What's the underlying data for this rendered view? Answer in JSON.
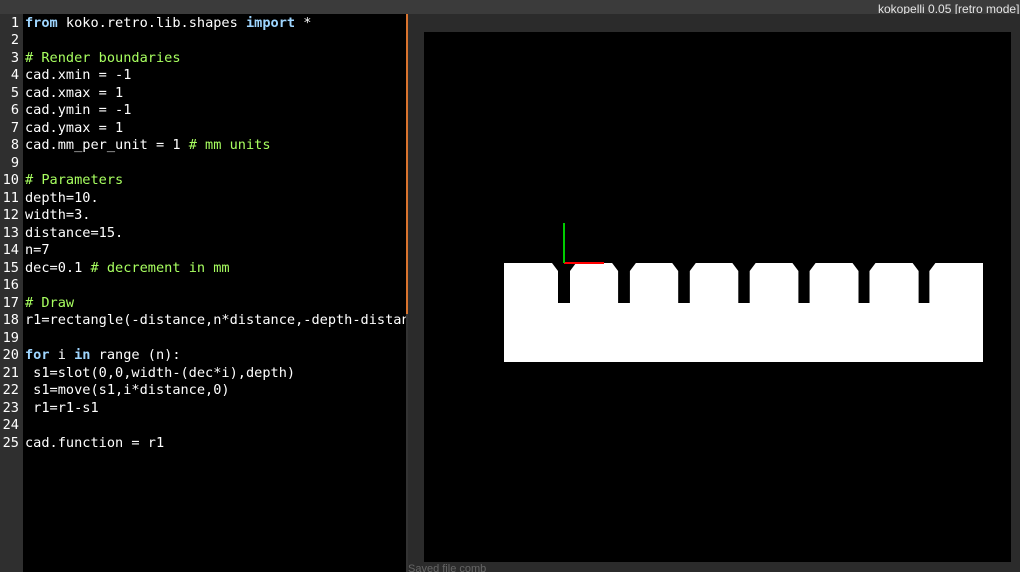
{
  "window": {
    "title": "kokopelli 0.05 [retro mode]"
  },
  "editor": {
    "lines": [
      {
        "num": "1",
        "tokens": [
          {
            "t": "from",
            "c": "kw"
          },
          {
            "t": " koko.retro.lib.shapes ",
            "c": ""
          },
          {
            "t": "import",
            "c": "kw"
          },
          {
            "t": " *",
            "c": ""
          }
        ]
      },
      {
        "num": "2",
        "tokens": []
      },
      {
        "num": "3",
        "tokens": [
          {
            "t": "# Render boundaries",
            "c": "cm"
          }
        ]
      },
      {
        "num": "4",
        "tokens": [
          {
            "t": "cad.xmin = -1",
            "c": ""
          }
        ]
      },
      {
        "num": "5",
        "tokens": [
          {
            "t": "cad.xmax = 1",
            "c": ""
          }
        ]
      },
      {
        "num": "6",
        "tokens": [
          {
            "t": "cad.ymin = -1",
            "c": ""
          }
        ]
      },
      {
        "num": "7",
        "tokens": [
          {
            "t": "cad.ymax = 1",
            "c": ""
          }
        ]
      },
      {
        "num": "8",
        "tokens": [
          {
            "t": "cad.mm_per_unit = 1 ",
            "c": ""
          },
          {
            "t": "# mm units",
            "c": "cm"
          }
        ]
      },
      {
        "num": "9",
        "tokens": []
      },
      {
        "num": "10",
        "tokens": [
          {
            "t": "# Parameters",
            "c": "cm"
          }
        ]
      },
      {
        "num": "11",
        "tokens": [
          {
            "t": "depth=10.",
            "c": ""
          }
        ]
      },
      {
        "num": "12",
        "tokens": [
          {
            "t": "width=3.",
            "c": ""
          }
        ]
      },
      {
        "num": "13",
        "tokens": [
          {
            "t": "distance=15.",
            "c": ""
          }
        ]
      },
      {
        "num": "14",
        "tokens": [
          {
            "t": "n=7",
            "c": ""
          }
        ]
      },
      {
        "num": "15",
        "tokens": [
          {
            "t": "dec=0.1 ",
            "c": ""
          },
          {
            "t": "# decrement in mm",
            "c": "cm"
          }
        ]
      },
      {
        "num": "16",
        "tokens": []
      },
      {
        "num": "17",
        "tokens": [
          {
            "t": "# Draw",
            "c": "cm"
          }
        ]
      },
      {
        "num": "18",
        "tokens": [
          {
            "t": "r1=rectangle(-distance,n*distance,-depth-distanc",
            "c": ""
          }
        ]
      },
      {
        "num": "19",
        "tokens": []
      },
      {
        "num": "20",
        "tokens": [
          {
            "t": "for",
            "c": "kw"
          },
          {
            "t": " i ",
            "c": ""
          },
          {
            "t": "in",
            "c": "kw"
          },
          {
            "t": " range (n):",
            "c": ""
          }
        ]
      },
      {
        "num": "21",
        "tokens": [
          {
            "t": " s1=slot(0,0,width-(dec*i),depth)",
            "c": ""
          }
        ]
      },
      {
        "num": "22",
        "tokens": [
          {
            "t": " s1=move(s1,i*distance,0)",
            "c": ""
          }
        ]
      },
      {
        "num": "23",
        "tokens": [
          {
            "t": " r1=r1-s1",
            "c": ""
          }
        ]
      },
      {
        "num": "24",
        "tokens": []
      },
      {
        "num": "25",
        "tokens": [
          {
            "t": "cad.function = r1",
            "c": ""
          }
        ]
      }
    ]
  },
  "status": {
    "text": "Saved file comb"
  },
  "viewport": {
    "colors": {
      "background": "#000000",
      "shape": "#ffffff",
      "x_axis": "#ff0000",
      "y_axis": "#00cc00"
    },
    "slot_count": 7
  }
}
